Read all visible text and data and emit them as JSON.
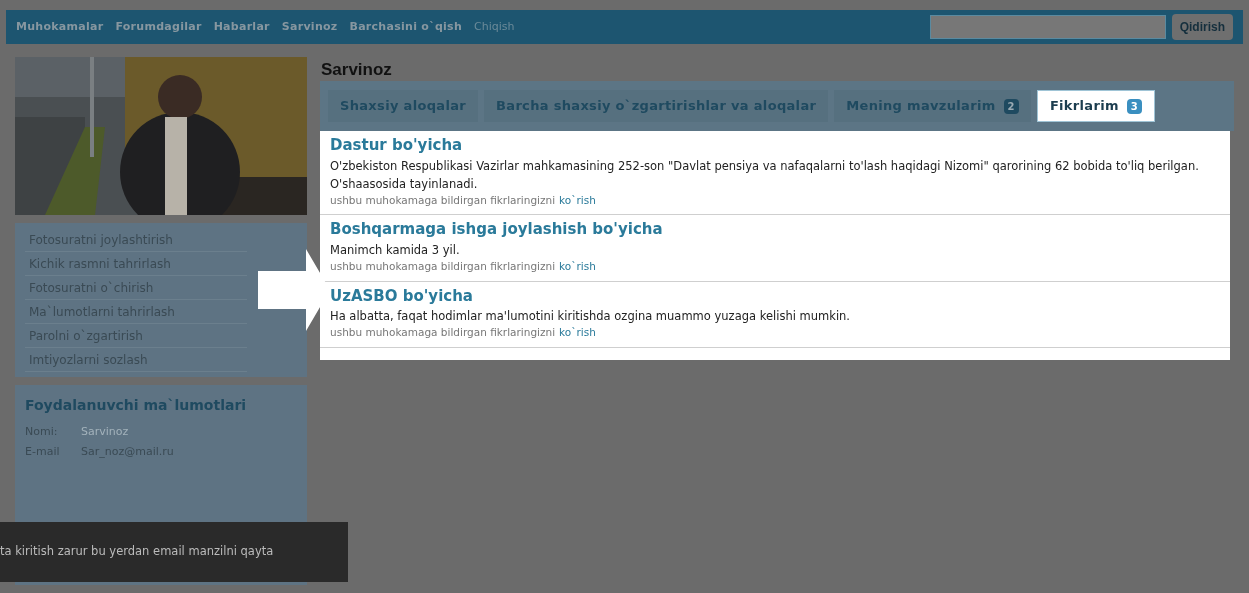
{
  "nav": {
    "links": [
      {
        "label": "Muhokamalar",
        "kind": "link"
      },
      {
        "label": "Forumdagilar",
        "kind": "link"
      },
      {
        "label": "Habarlar",
        "kind": "link"
      },
      {
        "label": "Sarvinoz",
        "kind": "link"
      },
      {
        "label": "Barchasini o`qish",
        "kind": "link"
      },
      {
        "label": "Chiqish",
        "kind": "logout"
      }
    ],
    "search_button": "Qidirish"
  },
  "profile": {
    "menu": [
      "Fotosuratni joylashtirish",
      "Kichik rasmni tahrirlash",
      "Fotosuratni o`chirish",
      "Ma`lumotlarni tahrirlash",
      "Parolni o`zgartirish",
      "Imtiyozlarni sozlash"
    ],
    "info": {
      "title": "Foydalanuvchi ma`lumotlari",
      "rows": [
        {
          "label": "Nomi:",
          "value": "Sarvinoz"
        },
        {
          "label": "E-mail",
          "value": "Sar_noz@mail.ru"
        }
      ]
    }
  },
  "main": {
    "title": "Sarvinoz",
    "tabs": [
      {
        "label": "Shaxsiy aloqalar",
        "selected": false
      },
      {
        "label": "Barcha shaxsiy o`zgartirishlar va aloqalar",
        "selected": false
      },
      {
        "label": "Mening mavzularim",
        "count": "2",
        "selected": false
      },
      {
        "label": "Fikrlarim",
        "count": "3",
        "selected": true
      }
    ],
    "comments": [
      {
        "title": "Dastur bo'yicha",
        "text": "O'zbekiston Respublikasi Vazirlar mahkamasining 252-son \"Davlat pensiya va nafaqalarni to'lash haqidagi Nizomi\" qarorining 62 bobida to'liq berilgan. O'shaasosida tayinlanadi.",
        "note": "ushbu muhokamaga bildirgan fikrlaringizni",
        "link": "ko`rish"
      },
      {
        "title": "Boshqarmaga ishga joylashish bo'yicha",
        "text": "Manimch kamida 3 yil.",
        "note": "ushbu muhokamaga bildirgan fikrlaringizni",
        "link": "ko`rish"
      },
      {
        "title": "UzASBO bo'yicha",
        "text": "Ha albatta, faqat hodimlar ma'lumotini kiritishda ozgina muammo yuzaga kelishi mumkin.",
        "note": "ushbu muhokamaga bildirgan fikrlaringizni",
        "link": "ko`rish"
      }
    ]
  },
  "toast": "ta kiritish zarur bu yerdan email manzilni qayta"
}
